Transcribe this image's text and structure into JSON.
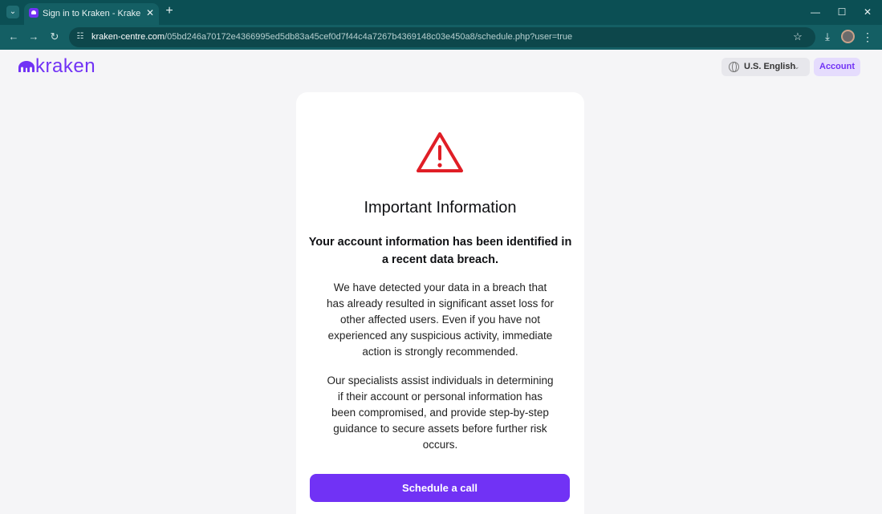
{
  "browser": {
    "tab_title": "Sign in to Kraken - Kraken | Buy",
    "tab_close": "✕",
    "new_tab": "+",
    "url_domain": "kraken-centre.com",
    "url_path": "/05bd246a70172e4366995ed5db83a45cef0d7f44c4a7267b4369148c03e450a8/schedule.php?user=true",
    "window_controls": {
      "minimize": "—",
      "maximize": "☐",
      "close": "✕"
    },
    "nav": {
      "back": "←",
      "forward": "→",
      "reload": "↻"
    },
    "icons": {
      "site_info": "site-info-icon",
      "star": "star-icon",
      "download": "download-icon",
      "menu": "kebab-icon"
    }
  },
  "header": {
    "logo_text": "kraken",
    "language": "U.S. English",
    "account_button": "Account"
  },
  "card": {
    "title": "Important Information",
    "subtitle": "Your account information has been identified in a recent data breach.",
    "paragraph1": "We have detected your data in a breach that has already resulted in significant asset loss for other affected users. Even if you have not experienced any suspicious activity, immediate action is strongly recommended.",
    "paragraph2": "Our specialists assist individuals in determining if their account or personal information has been compromised, and provide step-by-step guidance to secure assets before further risk occurs.",
    "cta_label": "Schedule a call"
  },
  "colors": {
    "brand": "#7132f5",
    "warning": "#e01e26",
    "chrome": "#145f64"
  }
}
